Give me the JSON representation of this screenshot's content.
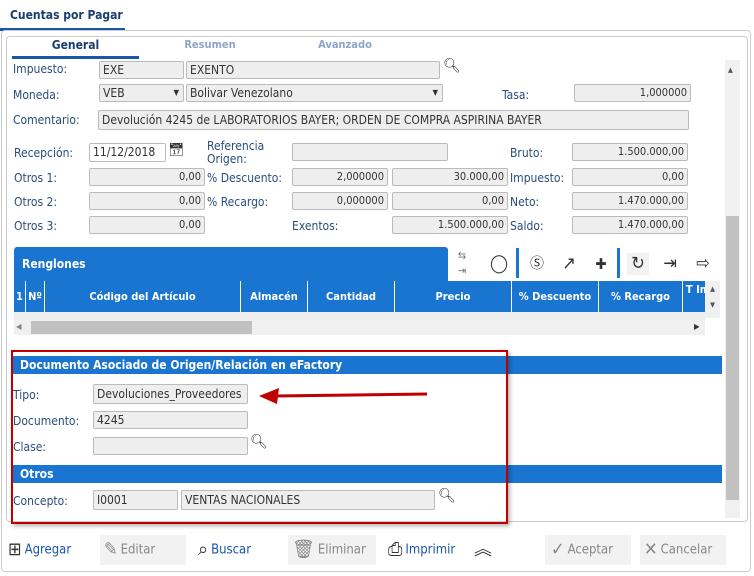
{
  "window": {
    "title": "Cuentas por Pagar"
  },
  "tabs": [
    {
      "label": "General",
      "active": true
    },
    {
      "label": "Resumen"
    },
    {
      "label": "Avanzado"
    }
  ],
  "form": {
    "impuesto": {
      "label": "Impuesto:",
      "code": "EXE",
      "name": "EXENTO"
    },
    "moneda": {
      "label": "Moneda:",
      "code": "VEB",
      "name": "Bolivar Venezolano"
    },
    "tasa": {
      "label": "Tasa:",
      "value": "1,000000"
    },
    "comentario": {
      "label": "Comentario:",
      "value": "Devolución 4245 de LABORATORIOS BAYER; ORDEN DE COMPRA ASPIRINA BAYER"
    },
    "recepcion": {
      "label": "Recepción:",
      "value": "11/12/2018"
    },
    "referencia": {
      "label": "Referencia Origen:",
      "value": ""
    },
    "bruto": {
      "label": "Bruto:",
      "value": "1.500.000,00"
    },
    "otros1": {
      "label": "Otros 1:",
      "value": "0,00"
    },
    "descuento": {
      "label": "% Descuento:",
      "pct": "2,000000",
      "amount": "30.000,00"
    },
    "impuesto_total": {
      "label": "Impuesto:",
      "value": "0,00"
    },
    "otros2": {
      "label": "Otros 2:",
      "value": "0,00"
    },
    "recargo": {
      "label": "% Recargo:",
      "pct": "0,000000",
      "amount": "0,00"
    },
    "neto": {
      "label": "Neto:",
      "value": "1.470.000,00"
    },
    "otros3": {
      "label": "Otros 3:",
      "value": "0,00"
    },
    "exentos": {
      "label": "Exentos:",
      "value": "1.500.000,00"
    },
    "saldo": {
      "label": "Saldo:",
      "value": "1.470.000,00"
    }
  },
  "renglones": {
    "title": "Renglones",
    "columns": [
      "1",
      "Nº",
      "Código del Artículo",
      "Almacén",
      "Cantidad",
      "Precio",
      "% Descuento",
      "% Recargo",
      "T Im"
    ]
  },
  "documento": {
    "title": "Documento Asociado de Origen/Relación en eFactory",
    "tipo": {
      "label": "Tipo:",
      "value": "Devoluciones_Proveedores"
    },
    "documento": {
      "label": "Documento:",
      "value": "4245"
    },
    "clase": {
      "label": "Clase:",
      "value": ""
    }
  },
  "otros": {
    "title": "Otros",
    "concepto": {
      "label": "Concepto:",
      "code": "I0001",
      "name": "VENTAS NACIONALES"
    }
  },
  "toolbar": {
    "agregar": "Agregar",
    "editar": "Editar",
    "buscar": "Buscar",
    "eliminar": "Eliminar",
    "imprimir": "Imprimir",
    "aceptar": "Aceptar",
    "cancelar": "Cancelar"
  },
  "colors": {
    "accent": "#1a75d1",
    "highlight": "#c00000"
  }
}
